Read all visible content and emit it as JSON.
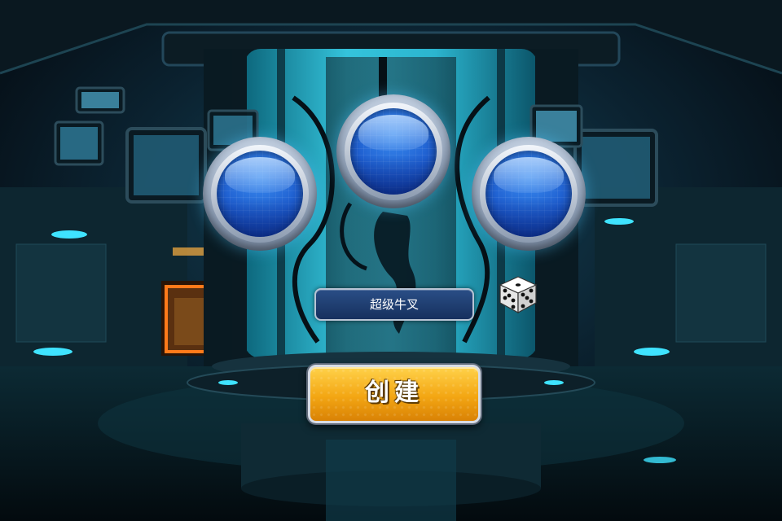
{
  "character": {
    "name": "超级牛叉"
  },
  "actions": {
    "create_label": "创建"
  },
  "slots": [
    {
      "id": "left"
    },
    {
      "id": "center"
    },
    {
      "id": "right"
    }
  ],
  "colors": {
    "accent_cyan": "#39d6f0",
    "button_gold": "#f3a613",
    "slot_blue": "#1f5fd0"
  },
  "icons": {
    "random_name": "dice-icon"
  }
}
